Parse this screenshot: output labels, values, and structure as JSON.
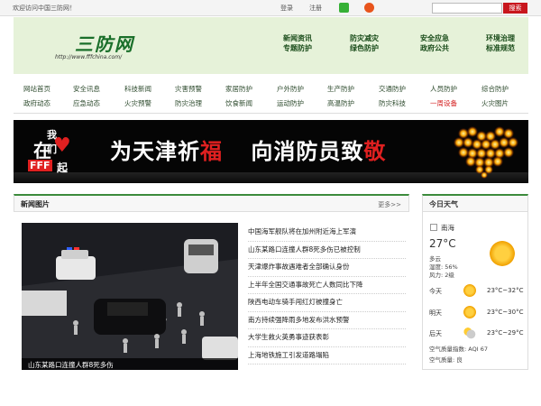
{
  "topbar": {
    "welcome": "欢迎访问中国三防网！",
    "login": "登录",
    "register": "注册",
    "search_placeholder": "",
    "search_button": "搜索"
  },
  "header": {
    "logo_text": "三防网",
    "logo_url": "http://www.fffchina.com/",
    "main_nav": [
      [
        "新闻资讯",
        "专题防护"
      ],
      [
        "防灾减灾",
        "绿色防护"
      ],
      [
        "安全应急",
        "政府公共"
      ],
      [
        "环境治理",
        "标准规范"
      ]
    ]
  },
  "sub_nav": {
    "row1": [
      "网站首页",
      "安全讯息",
      "科技新闻",
      "灾害预警",
      "家居防护",
      "户外防护",
      "生产防护",
      "交通防护",
      "人员防护",
      "综合防护"
    ],
    "row2": [
      "政府动态",
      "应急动态",
      "火灾预警",
      "防灾治理",
      "饮食新闻",
      "运动防护",
      "高温防护",
      "防灾科技",
      "一周设备",
      "火灾图片"
    ],
    "highlight": "一周设备"
  },
  "banner": {
    "left_top": "我们",
    "left_mid": "在",
    "left_logo": "FFF",
    "left_bottom": "起",
    "part1": "为天津祈",
    "part1_red": "福",
    "part2": "向消防员致",
    "part2_red": "敬"
  },
  "news": {
    "title": "新闻图片",
    "more": "更多>>",
    "caption": "山东某路口连撞人群8死多伤",
    "pages": [
      "1",
      "2",
      "3",
      "4",
      "5"
    ],
    "active_page": "2",
    "items": [
      "中国海军舰队将在加州附近海上军演",
      "山东某路口连撞人群8死多伤已被控制",
      "天津爆炸事故遇难者全部确认身份",
      "上半年全国交通事故死亡人数同比下降",
      "陕西电动车骑手闯红灯被撞身亡",
      "南方持续强降雨多地发布洪水预警",
      "大学生救火英勇事迹获表彰",
      "上海地铁施工引发道路塌陷"
    ]
  },
  "weather": {
    "title": "今日天气",
    "city": "南海",
    "temp": "27°C",
    "desc": "多云",
    "humidity": "湿度: 56%",
    "wind": "风力: 2级",
    "forecast": [
      {
        "day": "今天",
        "range": "23°C~32°C",
        "icon": "sun-icon"
      },
      {
        "day": "明天",
        "range": "23°C~30°C",
        "icon": "sun-icon"
      },
      {
        "day": "后天",
        "range": "23°C~29°C",
        "icon": "cloud-icon"
      }
    ],
    "aqi": "空气质量指数: AQI 67",
    "aqi_level": "空气质量: 良"
  }
}
